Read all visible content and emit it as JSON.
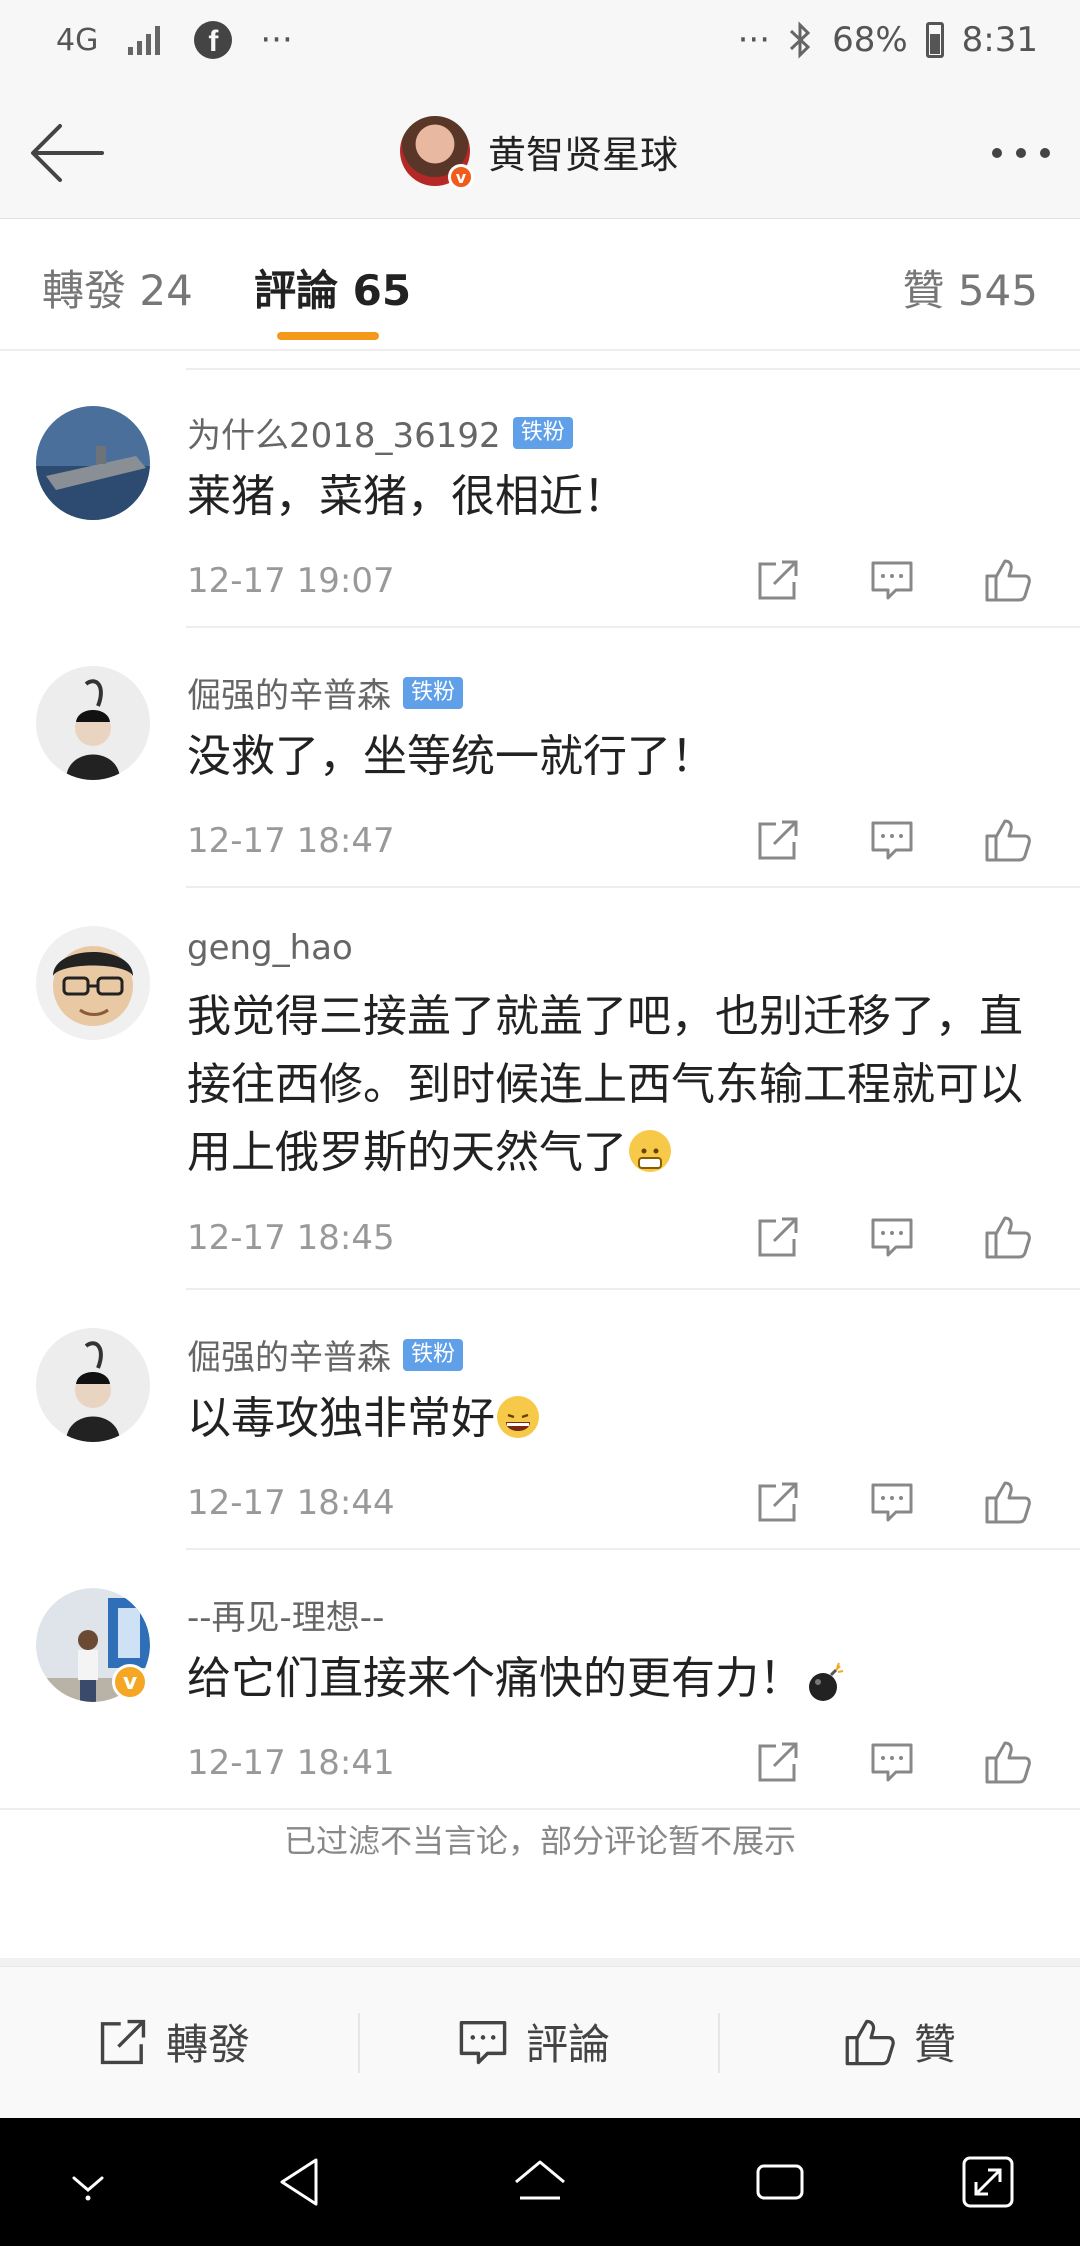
{
  "status_bar": {
    "network": "4G",
    "dots_left": "···",
    "dots_right": "···",
    "battery": "68%",
    "time": "8:31"
  },
  "header": {
    "title": "黄智贤星球",
    "back_icon": "back-arrow-icon",
    "more_icon": "more-icon"
  },
  "tabs": [
    {
      "label": "轉發 24"
    },
    {
      "label": "評論 65"
    },
    {
      "label": "贊 545"
    }
  ],
  "comments": [
    {
      "name": "为什么2018_36192",
      "badge": "铁粉",
      "text": "莱猪，菜猪，很相近！",
      "time": "12-17 19:07"
    },
    {
      "name": "倔强的辛普森",
      "badge": "铁粉",
      "text": "没救了，坐等统一就行了！",
      "time": "12-17 18:47"
    },
    {
      "name": "geng_hao",
      "badge": "",
      "text": "我觉得三接盖了就盖了吧，也别迁移了，直接往西修。到时候连上西气东输工程就可以用上俄罗斯的天然气了",
      "time": "12-17 18:45"
    },
    {
      "name": "倔强的辛普森",
      "badge": "铁粉",
      "text": "以毒攻独非常好",
      "time": "12-17 18:44"
    },
    {
      "name": "--再见-理想--",
      "badge": "",
      "text": "给它们直接来个痛快的更有力！",
      "time": "12-17 18:41"
    }
  ],
  "filter_note": "已过滤不当言论，部分评论暂不展示",
  "bottom_bar": {
    "repost": "轉發",
    "comment": "評論",
    "like": "贊"
  },
  "colors": {
    "accent": "#f49a1a",
    "fan_badge": "#5fa0e8",
    "verified": "#f25c1a"
  }
}
